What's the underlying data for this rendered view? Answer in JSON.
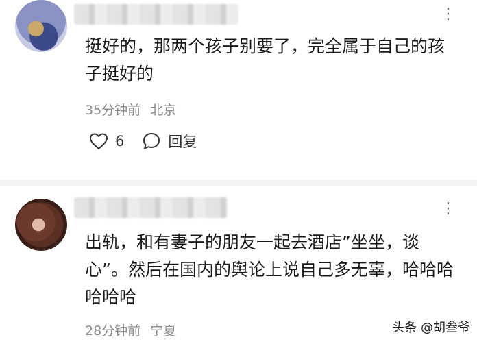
{
  "comments": [
    {
      "content": "挺好的，那两个孩子别要了，完全属于自己的孩子挺好的",
      "time": "35分钟前",
      "location": "北京",
      "likes": "6",
      "reply_label": "回复"
    },
    {
      "content": "出轨，和有妻子的朋友一起去酒店”坐坐，谈心”。然后在国内的舆论上说自己多无辜，哈哈哈哈哈哈",
      "time": "28分钟前",
      "location": "宁夏"
    }
  ],
  "more_glyph": "⋮",
  "watermark": "头条 @胡叁爷"
}
